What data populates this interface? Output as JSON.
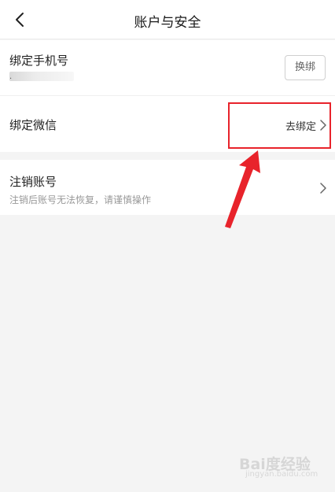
{
  "header": {
    "title": "账户与安全",
    "back_icon": "chevron-left-icon"
  },
  "phone": {
    "label": "绑定手机号",
    "masked_prefix": "·",
    "rebind_button": "换绑"
  },
  "wechat": {
    "label": "绑定微信",
    "action": "去绑定"
  },
  "deactivate": {
    "label": "注销账号",
    "description": "注销后账号无法恢复，请谨慎操作"
  },
  "watermark": {
    "text": "Bai度经验",
    "sub": "jingyan.baidu.com"
  },
  "colors": {
    "highlight": "#e8232b",
    "background": "#f4f4f4"
  }
}
